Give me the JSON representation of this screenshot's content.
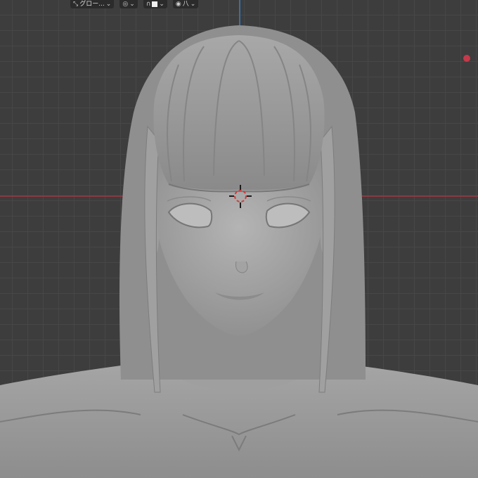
{
  "header": {
    "orientation_label": "グロー...",
    "items": [
      {
        "name": "transform-orientation",
        "icon": "orientation-icon"
      },
      {
        "name": "pivot-point",
        "icon": "pivot-icon"
      },
      {
        "name": "snapping",
        "icon": "magnet-icon"
      },
      {
        "name": "proportional-editing",
        "icon": "proportional-icon"
      }
    ],
    "overlay_label": "八"
  },
  "colors": {
    "background": "#3d3d3d",
    "grid": "#474747",
    "x_axis": "#8a3a42",
    "z_axis": "#3b6fa8",
    "mesh": "#9a9a9a",
    "cursor": "#d23a3a"
  }
}
